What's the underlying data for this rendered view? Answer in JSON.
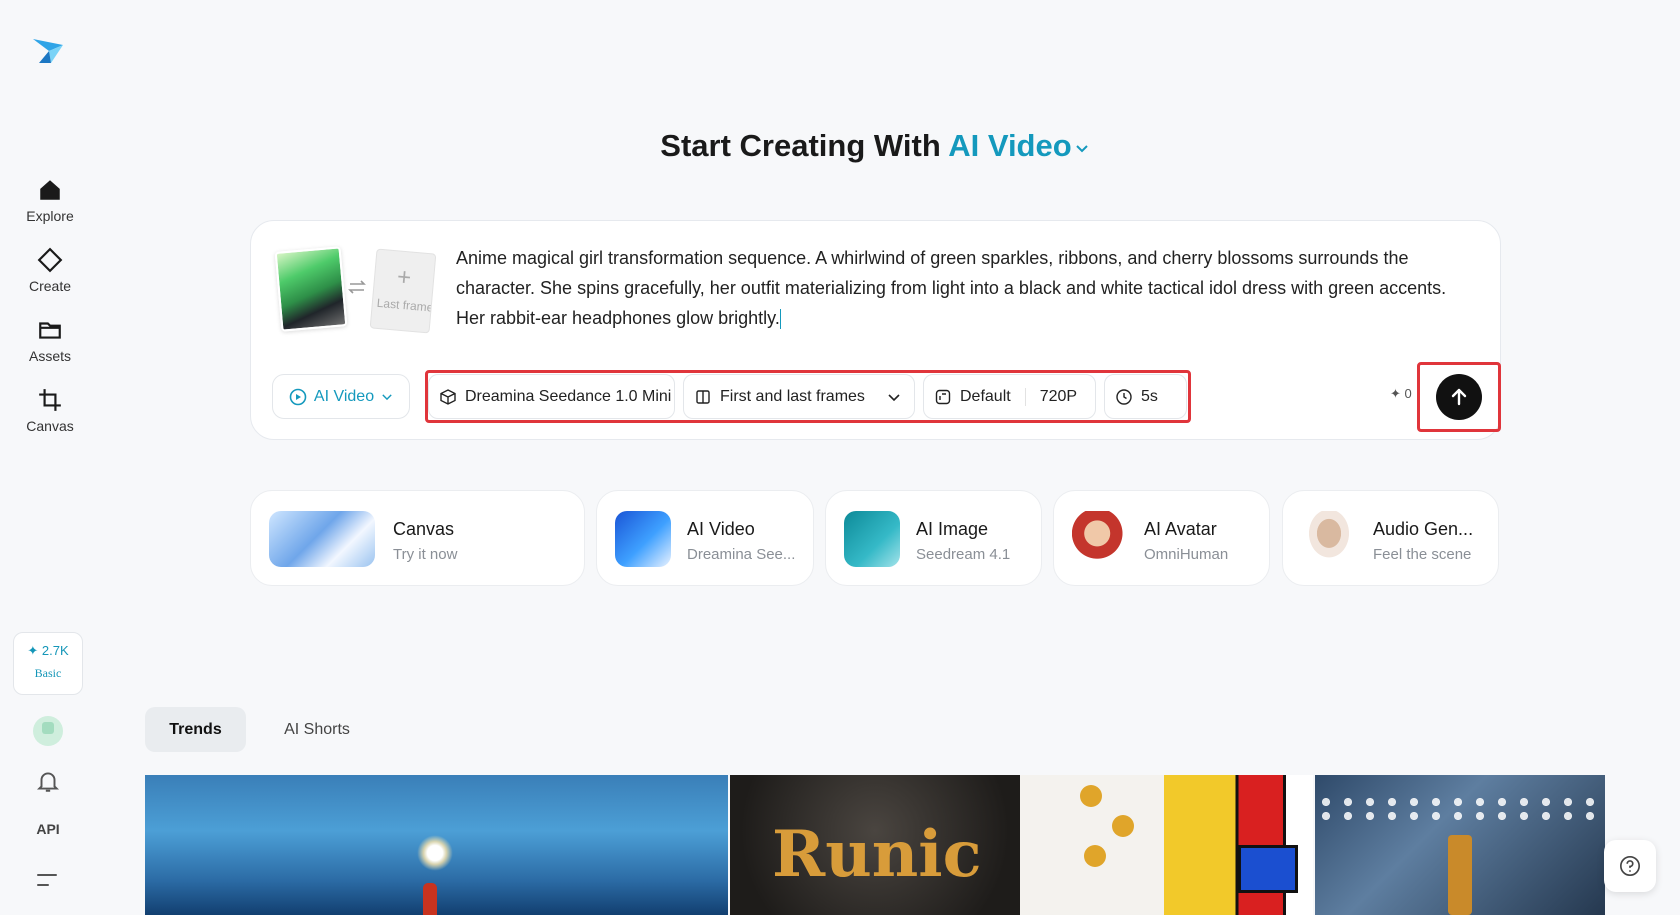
{
  "sidebar": {
    "items": [
      {
        "label": "Explore",
        "icon": "home-icon"
      },
      {
        "label": "Create",
        "icon": "diamond-icon"
      },
      {
        "label": "Assets",
        "icon": "folder-icon"
      },
      {
        "label": "Canvas",
        "icon": "crop-icon"
      }
    ],
    "credits": {
      "amount": "2.7K",
      "tier": "Basic"
    },
    "api_label": "API"
  },
  "header": {
    "title_prefix": "Start Creating With ",
    "title_accent": "AI Video"
  },
  "prompt": {
    "last_frame_label": "Last frame",
    "text": "Anime magical girl transformation sequence. A whirlwind of green sparkles, ribbons, and cherry blossoms surrounds the character. She spins gracefully, her outfit materializing from light into a black and white tactical idol dress with green accents. Her rabbit-ear headphones glow brightly.",
    "mode_label": "AI Video",
    "model_label": "Dreamina Seedance 1.0 Mini",
    "frames_label": "First and last frames",
    "ratio_label": "Default",
    "resolution_label": "720P",
    "duration_label": "5s",
    "credit_cost": "0"
  },
  "tools": [
    {
      "name": "Canvas",
      "sub": "Try it now"
    },
    {
      "name": "AI Video",
      "sub": "Dreamina See..."
    },
    {
      "name": "AI Image",
      "sub": "Seedream 4.1"
    },
    {
      "name": "AI Avatar",
      "sub": "OmniHuman"
    },
    {
      "name": "Audio Gen...",
      "sub": "Feel the scene"
    }
  ],
  "tabs": [
    {
      "label": "Trends"
    },
    {
      "label": "AI Shorts"
    }
  ],
  "gallery": {
    "tile2_text": "Runic"
  },
  "colors": {
    "accent": "#1499bd",
    "highlight": "#e0353b",
    "background": "#f7f8fa"
  }
}
